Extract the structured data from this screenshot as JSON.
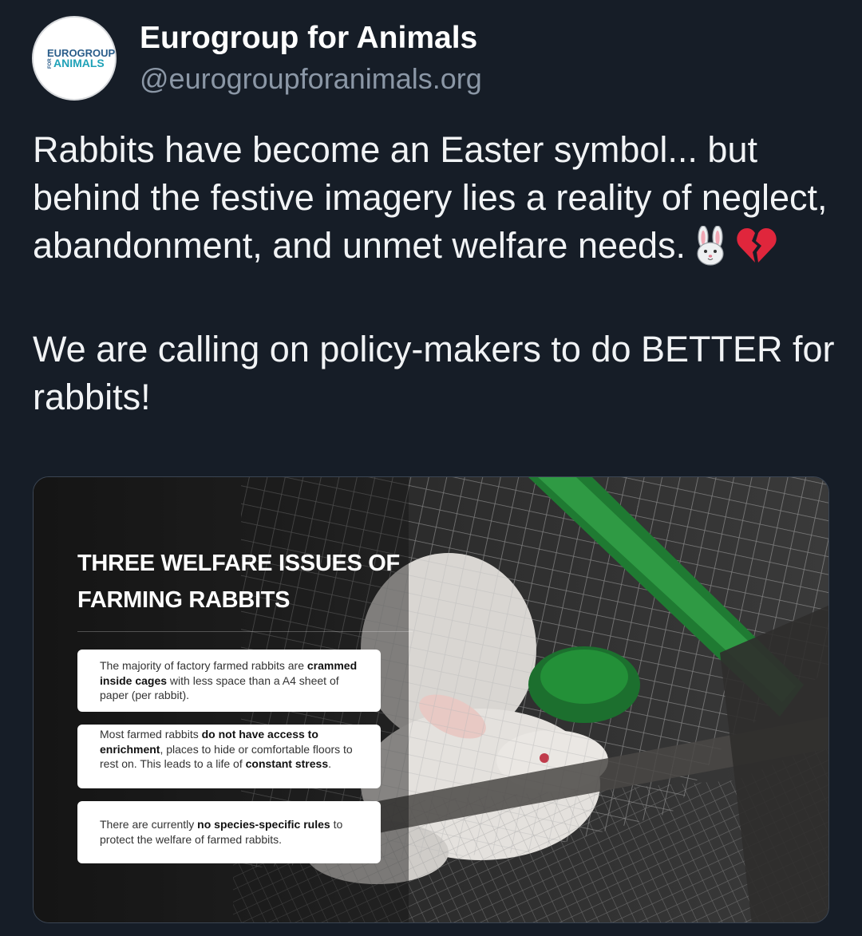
{
  "author": {
    "display_name": "Eurogroup for Animals",
    "handle": "@eurogroupforanimals.org",
    "avatar_text": {
      "line1": "EUROGROUP",
      "line2": "ANIMALS",
      "vertical": "FOR"
    }
  },
  "post": {
    "paragraph1": "Rabbits have become an Easter symbol... but behind the festive imagery lies a reality of neglect, abandonment, and unmet welfare needs.",
    "paragraph1_emojis": [
      "rabbit-face-emoji",
      "broken-heart-emoji"
    ],
    "paragraph2": "We are calling on policy-makers to do BETTER for rabbits!"
  },
  "media": {
    "title_line1": "THREE WELFARE ISSUES OF",
    "title_line2": "FARMING RABBITS",
    "cards": [
      {
        "pre": "The majority of factory farmed rabbits are ",
        "bold": "crammed inside cages",
        "post": " with less space than a A4 sheet of paper (per rabbit)."
      },
      {
        "pre": "Most farmed rabbits ",
        "bold": "do not have access to enrichment",
        "mid": ", places to hide or comfortable floors to rest on. This leads to a life of ",
        "bold2": "constant stress",
        "post": "."
      },
      {
        "pre": "There are currently ",
        "bold": "no species-specific rules",
        "post": " to protect the welfare of farmed rabbits."
      }
    ]
  },
  "colors": {
    "background": "#161d27",
    "handle": "#8b97a6",
    "logo_blue": "#2a5d8a",
    "logo_teal": "#1fa2b8",
    "cage_green": "#1f7a32"
  }
}
